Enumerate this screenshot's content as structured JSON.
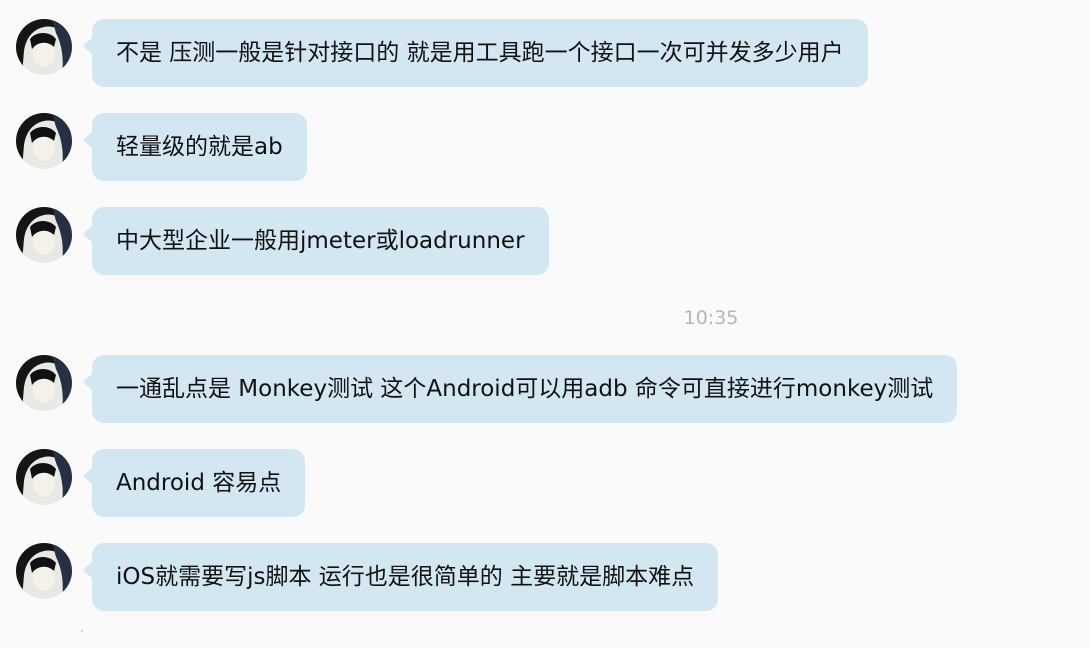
{
  "messages": [
    {
      "avatar": "user-avatar",
      "text": "不是  压测一般是针对接口的  就是用工具跑一个接口一次可并发多少用户"
    },
    {
      "avatar": "user-avatar",
      "text": "轻量级的就是ab"
    },
    {
      "avatar": "user-avatar",
      "text": "中大型企业一般用jmeter或loadrunner"
    },
    {
      "avatar": "user-avatar",
      "text": "一通乱点是 Monkey测试 这个Android可以用adb 命令可直接进行monkey测试"
    },
    {
      "avatar": "user-avatar",
      "text": "Android 容易点"
    },
    {
      "avatar": "user-avatar",
      "text": "iOS就需要写js脚本  运行也是很简单的  主要就是脚本难点"
    }
  ],
  "timestamp": "10:35",
  "colors": {
    "bubble": "#d3e7f3",
    "background": "#fafafa",
    "timestamp": "#b6b6b6"
  }
}
